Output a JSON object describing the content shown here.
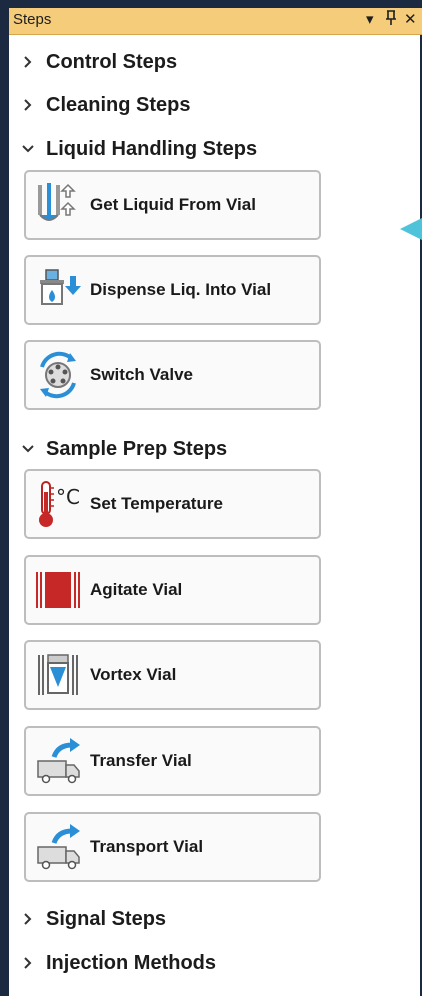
{
  "panel": {
    "title": "Steps",
    "dropdown_icon": "dropdown-triangle-icon",
    "pin_icon": "pin-icon",
    "close_icon": "close-icon"
  },
  "sections": {
    "control": {
      "label": "Control Steps",
      "expanded": false
    },
    "cleaning": {
      "label": "Cleaning Steps",
      "expanded": false
    },
    "liquid": {
      "label": "Liquid Handling Steps",
      "expanded": true,
      "steps": [
        {
          "label": "Get Liquid From Vial",
          "icon": "get-liquid-icon"
        },
        {
          "label": "Dispense Liq. Into Vial",
          "icon": "dispense-liquid-icon"
        },
        {
          "label": "Switch Valve",
          "icon": "switch-valve-icon"
        }
      ]
    },
    "sampleprep": {
      "label": "Sample Prep Steps",
      "expanded": true,
      "steps": [
        {
          "label": "Set Temperature",
          "icon": "thermometer-icon"
        },
        {
          "label": "Agitate Vial",
          "icon": "agitate-icon"
        },
        {
          "label": "Vortex Vial",
          "icon": "vortex-icon"
        },
        {
          "label": "Transfer Vial",
          "icon": "truck-transfer-icon"
        },
        {
          "label": "Transport Vial",
          "icon": "truck-transport-icon"
        }
      ]
    },
    "signal": {
      "label": "Signal Steps",
      "expanded": false
    },
    "injection": {
      "label": "Injection Methods",
      "expanded": false
    }
  },
  "colors": {
    "titlebar": "#f5cc7a",
    "frame": "#1b2a40",
    "accent": "#2a8fd6",
    "pointer": "#4fc3d9"
  }
}
